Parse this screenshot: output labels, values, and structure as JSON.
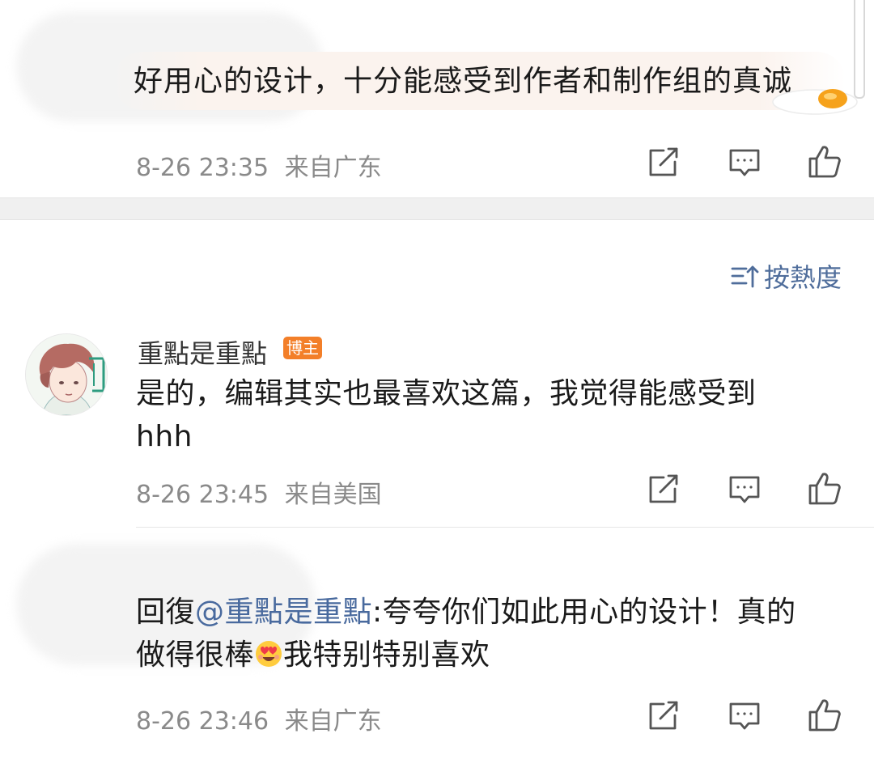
{
  "comment1": {
    "text": "好用心的设计，十分能感受到作者和制作组的真诚",
    "time": "8-26 23:35",
    "location": "来自广东"
  },
  "sort": {
    "label": "按熱度"
  },
  "comment2": {
    "author": "重點是重點",
    "badge": "博主",
    "text_line1": "是的，编辑其实也最喜欢这篇，我觉得能感受到",
    "text_line2": "hhh",
    "time": "8-26 23:45",
    "location": "来自美国"
  },
  "comment3": {
    "reply_prefix": "回復",
    "mention": "@重點是重點",
    "text_line1_rest": ":夸夸你们如此用心的设计！真的",
    "text_line2_a": "做得很棒",
    "text_line2_b": "我特别特别喜欢",
    "time": "8-26 23:46",
    "location": "来自广东"
  },
  "icons": {
    "share": "share-icon",
    "comment": "comment-icon",
    "like": "thumbs-up-icon",
    "sort": "sort-icon",
    "emoji": "heart-eyes-emoji-icon",
    "egg": "fried-egg-sticker-icon"
  },
  "colors": {
    "accent": "#4f6d9b",
    "badge": "#f37f29",
    "meta": "#8a8a8a"
  }
}
